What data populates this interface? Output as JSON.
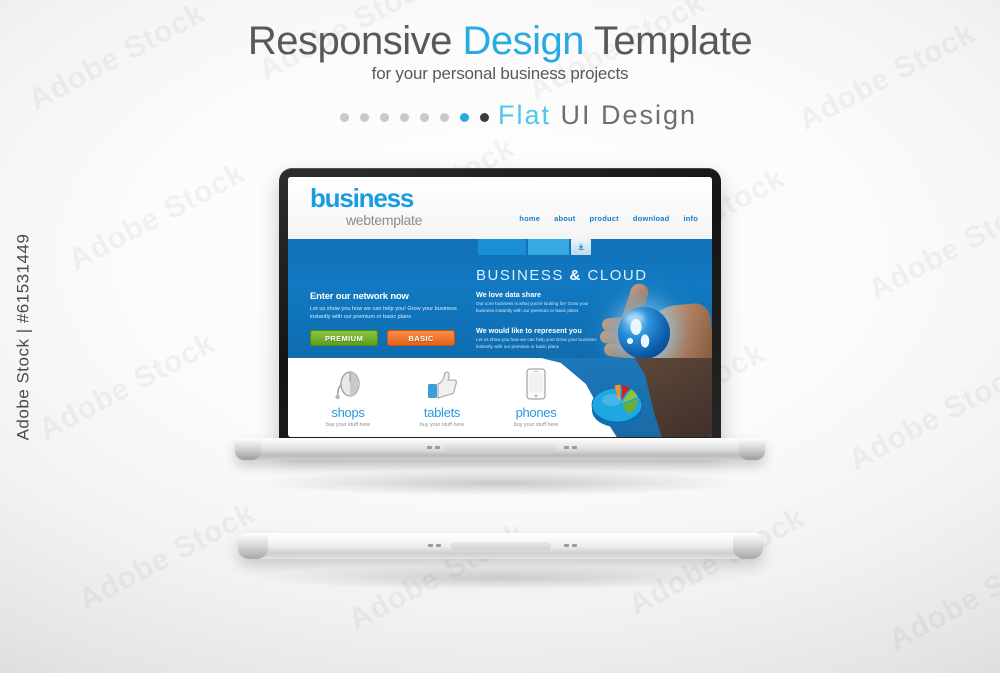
{
  "watermark": {
    "side_text": "Adobe Stock | #61531449",
    "tile_text": "Adobe Stock"
  },
  "header": {
    "title_part1": "Responsive ",
    "title_accent": "Design",
    "title_part2": " Template",
    "subtitle": "for your personal business projects",
    "tagline_accent": "Flat",
    "tagline_rest": " UI  Design",
    "dots": [
      {
        "state": "inactive"
      },
      {
        "state": "inactive"
      },
      {
        "state": "inactive"
      },
      {
        "state": "inactive"
      },
      {
        "state": "inactive"
      },
      {
        "state": "inactive"
      },
      {
        "state": "active"
      },
      {
        "state": "dark"
      }
    ],
    "colors": {
      "accent_blue": "#29ABE2",
      "text_gray": "#58595b",
      "dot_gray": "#c8c9ca",
      "dot_dark": "#3b3b3b"
    }
  },
  "website": {
    "logo": {
      "primary": "business",
      "secondary": "webtemplate"
    },
    "nav": [
      {
        "label": "home"
      },
      {
        "label": "about"
      },
      {
        "label": "product"
      },
      {
        "label": "download"
      },
      {
        "label": "info"
      }
    ],
    "search": {
      "field1_value": "",
      "field2_value": "",
      "button_icon": "download-icon"
    },
    "hero": {
      "title_light": "BUSINESS ",
      "title_bold": "&",
      "title_light2": " CLOUD",
      "left": {
        "heading": "Enter our network now",
        "body": "Let us show you how we can help you! Grow your business instantly with our premium or basic plans",
        "button_premium": "PREMIUM",
        "button_basic": "BASIC"
      },
      "mid": [
        {
          "heading": "We love data share",
          "body": "Our core business is what  you're looking for! Grow your business instantly with our premium or basic plans"
        },
        {
          "heading": "We would like to represent you",
          "body": "Let us show you how we can help you! Grow your business instantly with our premium or basic plans"
        }
      ],
      "image": "hand-holding-globe"
    },
    "features": [
      {
        "icon": "mouse-icon",
        "title": "shops",
        "subtitle": "buy your stuff here"
      },
      {
        "icon": "thumbs-up-icon",
        "title": "tablets",
        "subtitle": "buy your stuff here"
      },
      {
        "icon": "smartphone-icon",
        "title": "phones",
        "subtitle": "buy your stuff here"
      }
    ],
    "pie_chart": {
      "icon": "pie-chart-icon",
      "slices": [
        {
          "color": "#1ea7e0",
          "share": 0.52
        },
        {
          "color": "#f7931e",
          "share": 0.14
        },
        {
          "color": "#d41f26",
          "share": 0.16
        },
        {
          "color": "#8cc63f",
          "share": 0.18
        }
      ]
    },
    "colors": {
      "brand_blue": "#1b9ce0",
      "hero_blue": "#1272b8",
      "nav_blue": "#1b7fc4",
      "green": "#8dc63f",
      "orange": "#f79044"
    }
  },
  "devices": {
    "open_laptop": "open-laptop",
    "closed_laptop": "closed-laptop"
  }
}
